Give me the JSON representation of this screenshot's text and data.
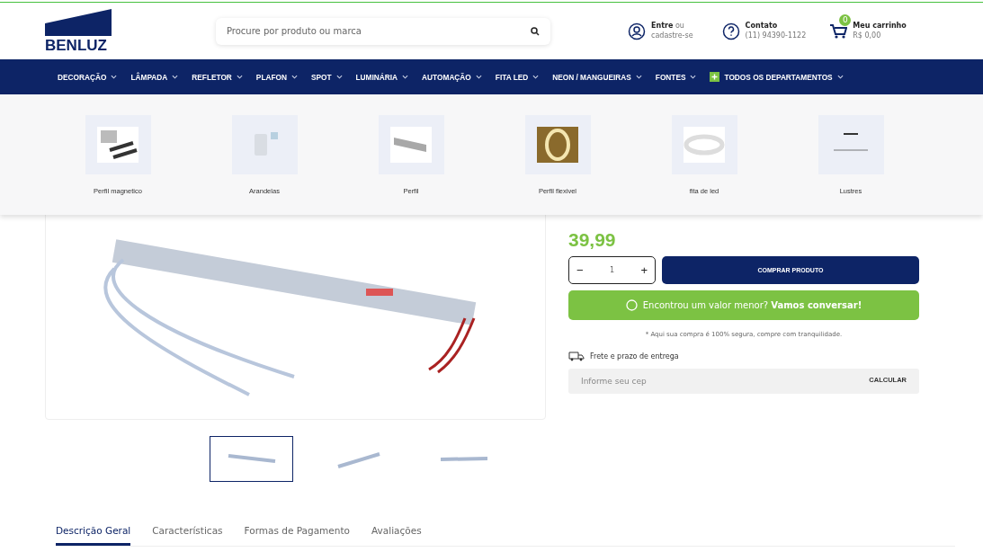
{
  "header": {
    "logo": "BENLUZ",
    "search": {
      "placeholder": "Procure por produto ou marca"
    },
    "account": {
      "title": "Entre",
      "suffix": "ou",
      "subtitle": "cadastre-se"
    },
    "contact": {
      "title": "Contato",
      "subtitle": "(11) 94390-1122"
    },
    "cart": {
      "title": "Meu carrinho",
      "total": "R$ 0,00",
      "count": "0"
    }
  },
  "nav": [
    {
      "label": "DECORAÇÃO",
      "kind": "menu"
    },
    {
      "label": "LÂMPADA",
      "kind": "menu"
    },
    {
      "label": "REFLETOR",
      "kind": "menu"
    },
    {
      "label": "PLAFON",
      "kind": "menu"
    },
    {
      "label": "SPOT",
      "kind": "menu"
    },
    {
      "label": "LUMINÁRIA",
      "kind": "menu"
    },
    {
      "label": "AUTOMAÇÃO",
      "kind": "menu"
    },
    {
      "label": "FITA LED",
      "kind": "menu"
    },
    {
      "label": "NEON / MANGUEIRAS",
      "kind": "menu"
    },
    {
      "label": "FONTES",
      "kind": "menu"
    },
    {
      "label": "TODOS OS DEPARTAMENTOS",
      "kind": "all"
    }
  ],
  "dropdown": [
    {
      "label": "Perfil magnetico"
    },
    {
      "label": "Arandelas"
    },
    {
      "label": "Perfil"
    },
    {
      "label": "Perfil flexivel"
    },
    {
      "label": "fita de led"
    },
    {
      "label": "Lustres"
    }
  ],
  "thumbnails": [
    {
      "selected": true
    },
    {
      "selected": false
    },
    {
      "selected": false
    }
  ],
  "product": {
    "price": "39,99",
    "quantity": "1",
    "qty_minus": "−",
    "qty_plus": "+",
    "buy": "COMPRAR PRODUTO",
    "whatsapp": "Encontrou um valor menor? **Vamos conversar!**",
    "note": "* Aqui sua compra é 100% segura, compre com tranquilidade.",
    "shipping_title": "Frete e prazo de entrega",
    "cep": {
      "placeholder": "Informe seu cep"
    },
    "calc": "CALCULAR"
  },
  "tabs": [
    {
      "label": "Descrição Geral",
      "selected": true
    },
    {
      "label": "Características",
      "selected": false
    },
    {
      "label": "Formas de Pagamento",
      "selected": false
    },
    {
      "label": "Avaliações",
      "selected": false
    }
  ]
}
